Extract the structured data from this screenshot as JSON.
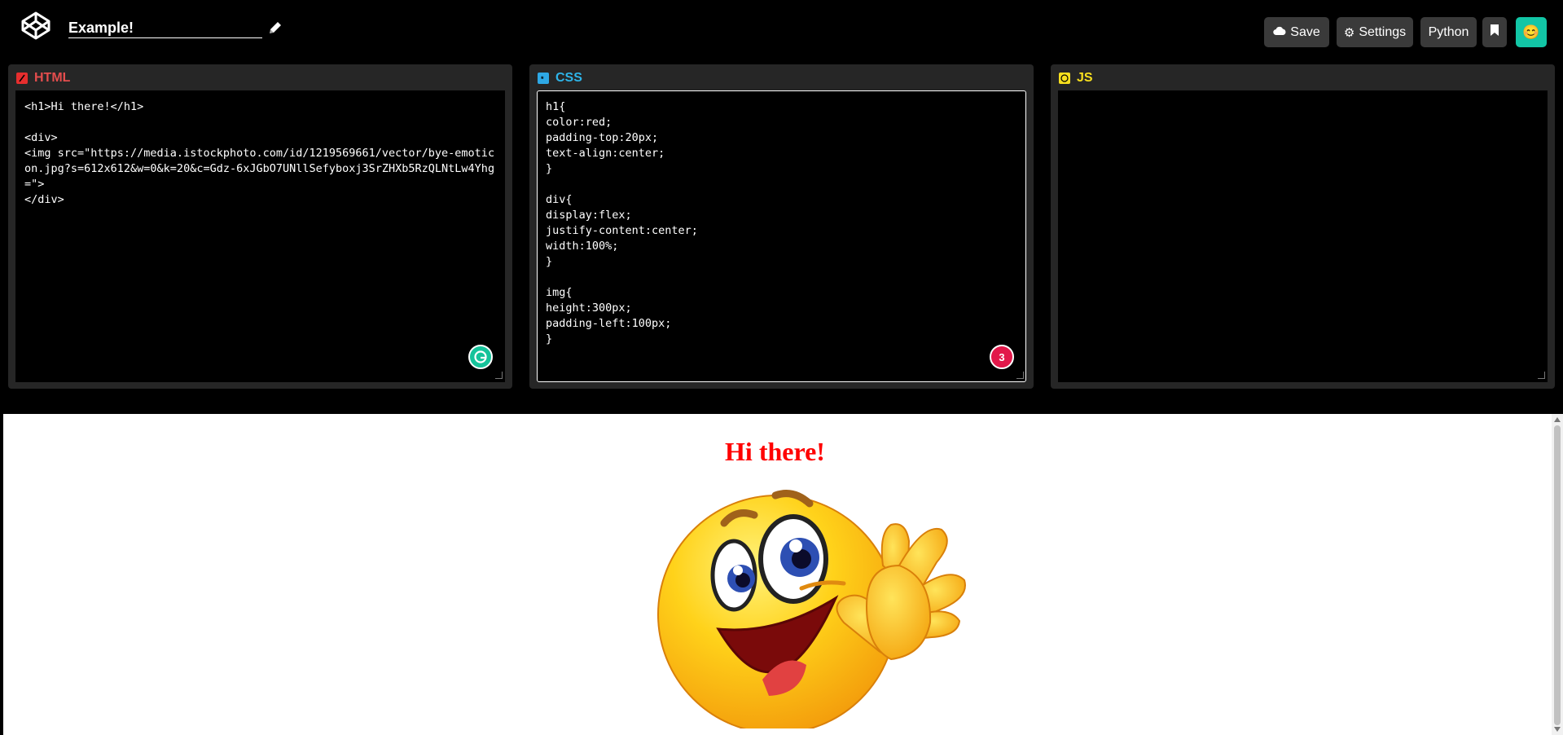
{
  "header": {
    "project_title": "Example!",
    "buttons": {
      "save": "Save",
      "settings": "Settings",
      "python": "Python",
      "avatar_emoji": "😊"
    },
    "icons": {
      "logo": "codepen-logo-icon",
      "edit": "pencil-icon",
      "save": "cloud-icon",
      "settings": "gear-icon",
      "bookmark": "bookmark-icon"
    }
  },
  "panels": {
    "html": {
      "label": "HTML",
      "color": "#e44d26",
      "code": "<h1>Hi there!</h1>\n\n<div>\n<img src=\"https://media.istockphoto.com/id/1219569661/vector/bye-emoticon.jpg?s=612x612&w=0&k=20&c=Gdz-6xJGbO7UNllSefyboxj3SrZHXb5RzQLNtLw4Yhg=\">\n</div>"
    },
    "css": {
      "label": "CSS",
      "color": "#2ea8e5",
      "code": "h1{\ncolor:red;\npadding-top:20px;\ntext-align:center;\n}\n\ndiv{\ndisplay:flex;\njustify-content:center;\nwidth:100%;\n}\n\nimg{\nheight:300px;\npadding-left:100px;\n}\n",
      "grammarly_count": "3"
    },
    "js": {
      "label": "JS",
      "color": "#f7df1e",
      "code": ""
    }
  },
  "preview": {
    "heading": "Hi there!",
    "heading_color": "#ff0000",
    "image": "waving-smiley-emoticon"
  }
}
